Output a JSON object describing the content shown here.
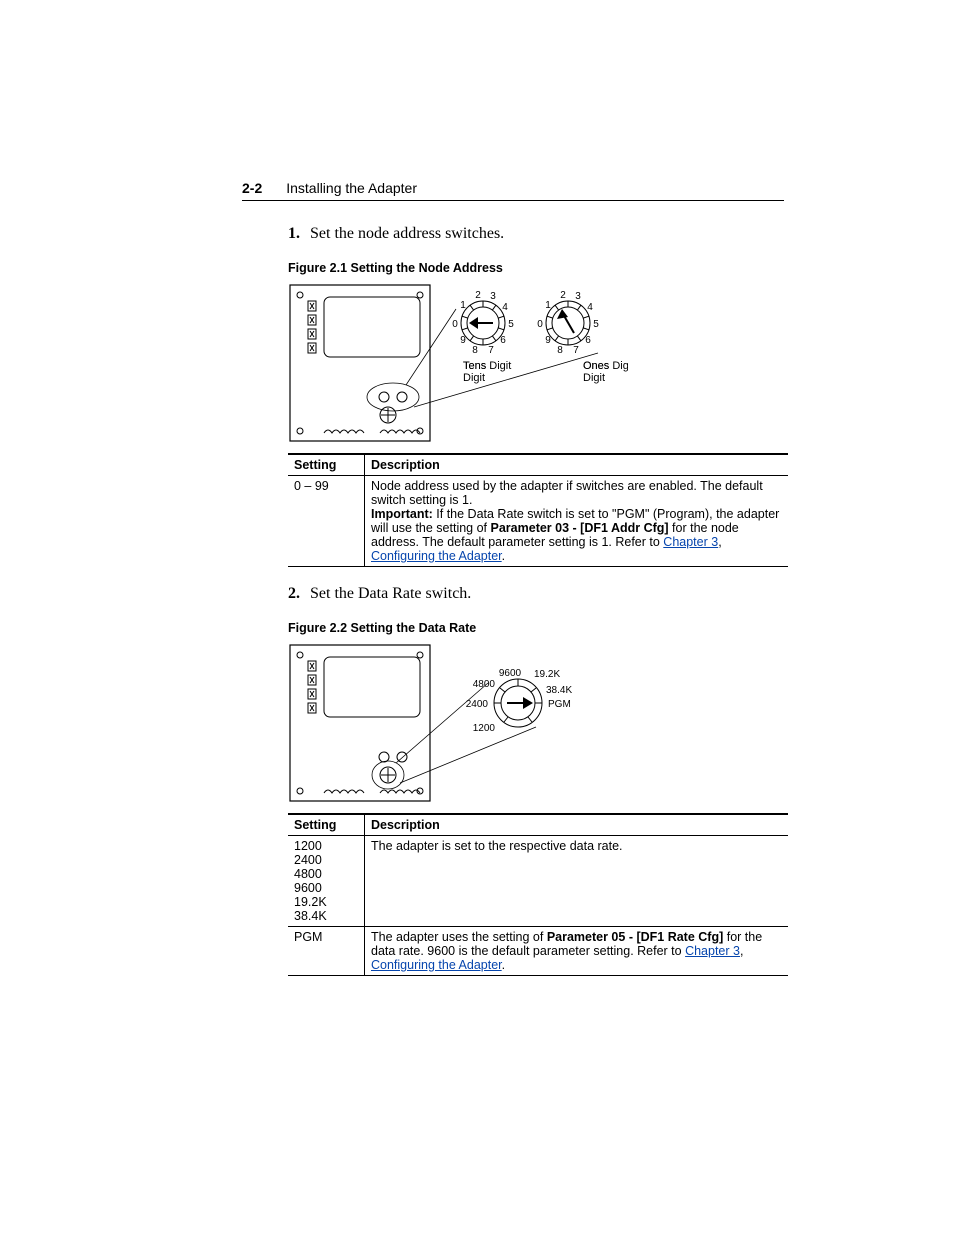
{
  "header": {
    "page_number": "2-2",
    "section_title": "Installing the Adapter"
  },
  "steps": {
    "s1": {
      "num": "1.",
      "text": "Set the node address switches."
    },
    "s2": {
      "num": "2.",
      "text": "Set the Data Rate switch."
    }
  },
  "figures": {
    "f1": {
      "caption": "Figure 2.1   Setting the Node Address"
    },
    "f2": {
      "caption": "Figure 2.2   Setting the Data Rate"
    }
  },
  "fig1": {
    "tens": "Tens\nDigit",
    "ones": "Ones\nDigit",
    "d0": "0",
    "d1": "1",
    "d2": "2",
    "d3": "3",
    "d4": "4",
    "d5": "5",
    "d6": "6",
    "d7": "7",
    "d8": "8",
    "d9": "9"
  },
  "fig2": {
    "r1200": "1200",
    "r2400": "2400",
    "r4800": "4800",
    "r9600": "9600",
    "r192": "19.2K",
    "r384": "38.4K",
    "rpgm": "PGM"
  },
  "tables": {
    "headers": {
      "setting": "Setting",
      "description": "Description"
    },
    "t1": {
      "setting": "0 – 99",
      "desc_a": "Node address used by the adapter if switches are enabled. The default switch setting is 1.",
      "imp": "Important:",
      "desc_b": " If the Data Rate switch is set to \"PGM\" (Program), the adapter will use the setting of ",
      "param": "Parameter 03 - [DF1 Addr Cfg]",
      "desc_c": " for the node address. The default parameter setting is 1. Refer to ",
      "link_ch": "Chapter 3",
      "sep": ", ",
      "link_cfg": "Configuring the Adapter",
      "dot": "."
    },
    "t2": {
      "r1": {
        "setting": "1200\n2400\n4800\n9600\n19.2K\n38.4K",
        "desc": "The adapter is set to the respective data rate."
      },
      "r2": {
        "setting": "PGM",
        "desc_a": "The adapter uses the setting of ",
        "param": "Parameter 05 - [DF1 Rate Cfg]",
        "desc_b": " for the data rate. 9600 is the default parameter setting. Refer to ",
        "link_ch": "Chapter 3",
        "sep": ", ",
        "link_cfg": "Configuring the Adapter",
        "dot": "."
      }
    }
  }
}
